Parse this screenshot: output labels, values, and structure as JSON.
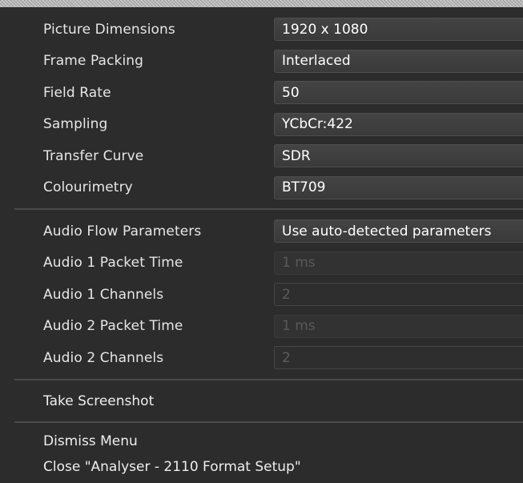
{
  "video": [
    {
      "label": "Picture Dimensions",
      "value": "1920 x 1080"
    },
    {
      "label": "Frame Packing",
      "value": "Interlaced"
    },
    {
      "label": "Field Rate",
      "value": "50"
    },
    {
      "label": "Sampling",
      "value": "YCbCr:422"
    },
    {
      "label": "Transfer Curve",
      "value": "SDR"
    },
    {
      "label": "Colourimetry",
      "value": "BT709"
    }
  ],
  "audio": {
    "flow_parameters": {
      "label": "Audio Flow Parameters",
      "value": "Use auto-detected parameters"
    },
    "a1_packet_time": {
      "label": "Audio 1 Packet Time",
      "value": "1 ms"
    },
    "a1_channels": {
      "label": "Audio 1 Channels",
      "value": "2"
    },
    "a2_packet_time": {
      "label": "Audio 2 Packet Time",
      "value": "1 ms"
    },
    "a2_channels": {
      "label": "Audio 2 Channels",
      "value": "2"
    }
  },
  "actions": {
    "take_screenshot": "Take Screenshot",
    "dismiss_menu": "Dismiss Menu",
    "close_window": "Close \"Analyser - 2110 Format Setup\""
  },
  "icons": {
    "dropdown": "chevron-down-icon",
    "stepper": "spinner-icon"
  },
  "colors": {
    "background": "#2c2c2c",
    "field_active": "#3f3f3f",
    "text": "#e6e6e6",
    "disabled_text": "#595959"
  }
}
